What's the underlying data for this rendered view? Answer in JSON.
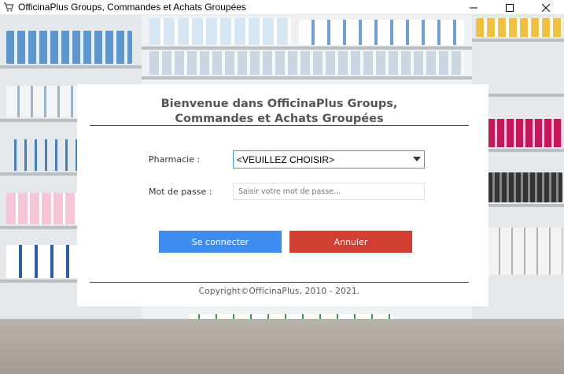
{
  "window": {
    "title": "OfficinaPlus Groups, Commandes et Achats Groupées",
    "app_icon": "shopping-cart-icon",
    "controls": [
      "minimize-icon",
      "maximize-icon",
      "close-icon"
    ]
  },
  "dialog": {
    "title_line1": "Bienvenue dans OfficinaPlus Groups,",
    "title_line2": "Commandes et Achats Groupées",
    "pharmacy_label": "Pharmacie :",
    "pharmacy_selected": "<VEUILLEZ CHOISIR>",
    "password_label": "Mot de passe :",
    "password_placeholder": "Saisir votre mot de passe...",
    "connect_label": "Se connecter",
    "cancel_label": "Annuler",
    "copyright": "Copyright©OfficinaPlus, 2010 - 2021."
  },
  "colors": {
    "connect": "#3d8cf0",
    "cancel": "#d13f33",
    "select_border": "#4a90d9"
  }
}
